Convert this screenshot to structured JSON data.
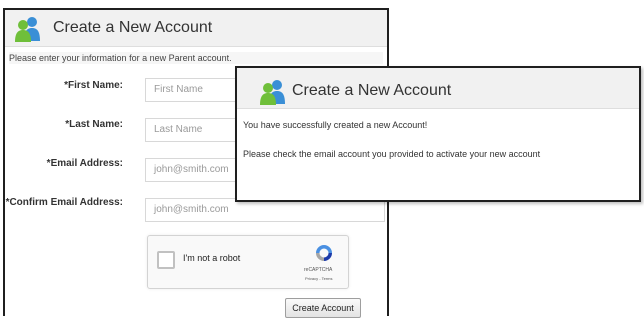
{
  "form_panel": {
    "title": "Create a New Account",
    "intro": "Please enter your information for a new Parent account.",
    "fields": [
      {
        "label": "*First Name:",
        "placeholder": "First Name"
      },
      {
        "label": "*Last Name:",
        "placeholder": "Last Name"
      },
      {
        "label": "*Email Address:",
        "placeholder": "john@smith.com"
      },
      {
        "label": "*Confirm Email Address:",
        "placeholder": "john@smith.com"
      }
    ],
    "recaptcha": {
      "label": "I'm not a robot",
      "brand": "reCAPTCHA",
      "terms": "Privacy - Terms"
    },
    "submit_label": "Create Account"
  },
  "success_panel": {
    "title": "Create a New Account",
    "message": "You have successfully created a new Account!",
    "instruction": "Please check the email account you provided to activate your new account"
  },
  "colors": {
    "header_bg": "#f1f1f1",
    "logo_green": "#6fbf3a",
    "logo_blue": "#3a8fd6",
    "border": "#1f1f1f"
  },
  "icons": {
    "logo": "users-logo-icon",
    "recaptcha": "recaptcha-icon"
  }
}
